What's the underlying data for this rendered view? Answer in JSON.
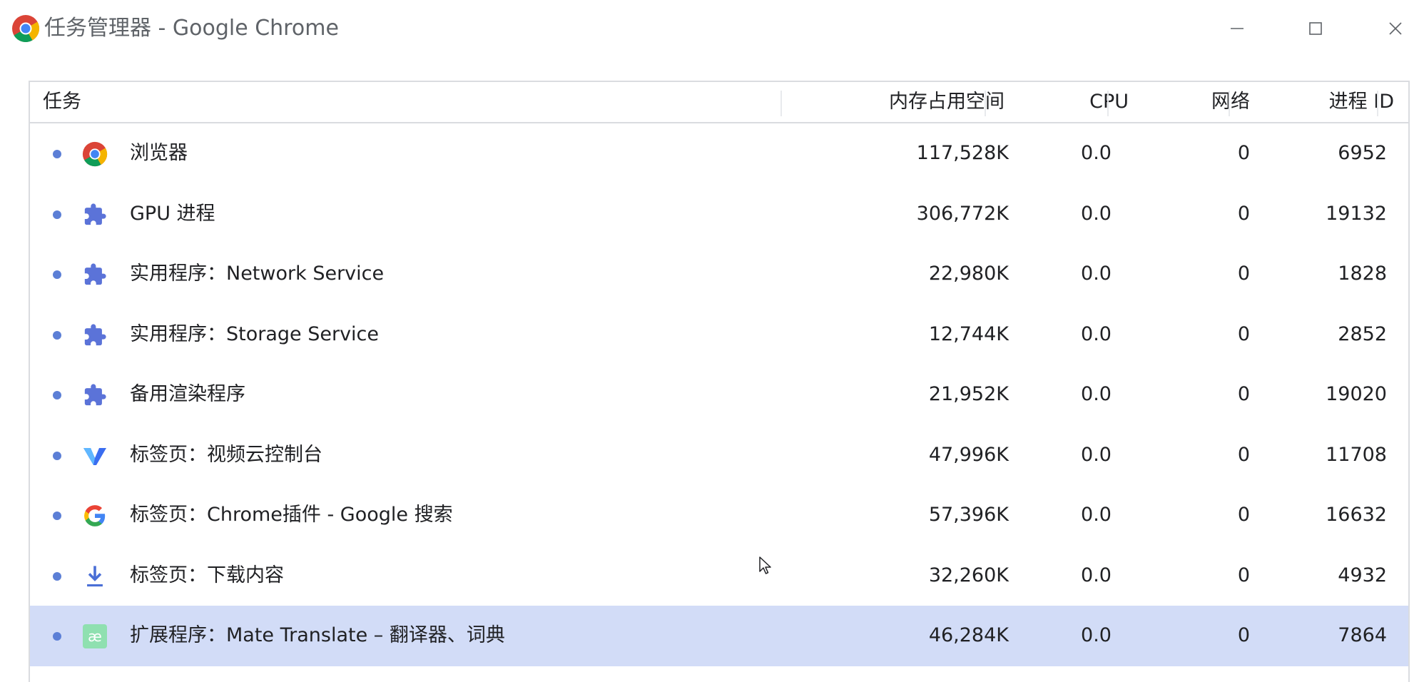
{
  "window": {
    "title": "任务管理器 - Google Chrome"
  },
  "titlebar_buttons": {
    "minimize_icon": "minimize-icon",
    "maximize_icon": "maximize-icon",
    "close_icon": "close-icon"
  },
  "table": {
    "columns": {
      "task": "任务",
      "memory": "内存占用空间",
      "cpu": "CPU",
      "network": "网络",
      "pid": "进程 ID"
    },
    "rows": [
      {
        "icon": "chrome-icon",
        "name": "浏览器",
        "memory": "117,528K",
        "cpu": "0.0",
        "network": "0",
        "pid": "6952",
        "selected": false
      },
      {
        "icon": "puzzle-icon",
        "name": "GPU 进程",
        "memory": "306,772K",
        "cpu": "0.0",
        "network": "0",
        "pid": "19132",
        "selected": false
      },
      {
        "icon": "puzzle-icon",
        "name": "实用程序：Network Service",
        "memory": "22,980K",
        "cpu": "0.0",
        "network": "0",
        "pid": "1828",
        "selected": false
      },
      {
        "icon": "puzzle-icon",
        "name": "实用程序：Storage Service",
        "memory": "12,744K",
        "cpu": "0.0",
        "network": "0",
        "pid": "2852",
        "selected": false
      },
      {
        "icon": "puzzle-icon",
        "name": "备用渲染程序",
        "memory": "21,952K",
        "cpu": "0.0",
        "network": "0",
        "pid": "19020",
        "selected": false
      },
      {
        "icon": "vod-v-icon",
        "name": "标签页：视频云控制台",
        "memory": "47,996K",
        "cpu": "0.0",
        "network": "0",
        "pid": "11708",
        "selected": false
      },
      {
        "icon": "google-g-icon",
        "name": "标签页：Chrome插件 - Google 搜索",
        "memory": "57,396K",
        "cpu": "0.0",
        "network": "0",
        "pid": "16632",
        "selected": false
      },
      {
        "icon": "download-icon",
        "name": "标签页：下载内容",
        "memory": "32,260K",
        "cpu": "0.0",
        "network": "0",
        "pid": "4932",
        "selected": false
      },
      {
        "icon": "mate-translate-icon",
        "name": "扩展程序：Mate Translate – 翻译器、词典",
        "memory": "46,284K",
        "cpu": "0.0",
        "network": "0",
        "pid": "7864",
        "selected": true
      }
    ]
  },
  "colors": {
    "selection": "#d2dcf7",
    "dot": "#5c7fd6",
    "puzzle": "#5b73d8",
    "border": "#dadce0"
  }
}
